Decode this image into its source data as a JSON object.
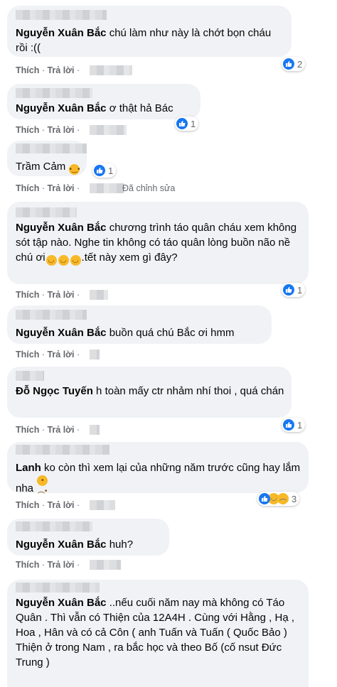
{
  "comments": [
    {
      "author": "Nguyễn Xuân Bắc",
      "text": " chú làm như này là chớt bọn cháu rồi :((",
      "like": "Thích",
      "reply": "Trả lời",
      "reactions": "2"
    },
    {
      "author": "Nguyễn Xuân Bắc",
      "text": " ơ thật hả Bác",
      "like": "Thích",
      "reply": "Trả lời",
      "reactions": "1"
    },
    {
      "author": "",
      "text": "Trầm Cảm ",
      "like": "Thích",
      "reply": "Trả lời",
      "edited": "Đã chỉnh sửa",
      "reactions": "1"
    },
    {
      "author": "Nguyễn Xuân Bắc",
      "text": " chương trình táo quân cháu xem không sót tập nào. Nghe tin không có táo quân lòng buồn não nề chú ơi",
      "text_after": ".tết này xem gì đây?",
      "like": "Thích",
      "reply": "Trả lời",
      "reactions": "1"
    },
    {
      "author": "Nguyễn Xuân Bắc",
      "text": " buồn quá chú Bắc ơi hmm",
      "like": "Thích",
      "reply": "Trả lời"
    },
    {
      "author": "Đỗ Ngọc Tuyến",
      "text": " h toàn mấy ctr nhảm nhí thoi , quá chán",
      "like": "Thích",
      "reply": "Trả lời",
      "reactions": "1"
    },
    {
      "author": "Lanh",
      "text": " ko còn thì xem lại của những năm trước cũng hay lắm nha ",
      "like": "Thích",
      "reply": "Trả lời",
      "reactions": "3"
    },
    {
      "author": "Nguyễn Xuân Bắc",
      "text": " huh?",
      "like": "Thích",
      "reply": "Trả lời"
    },
    {
      "author": "Nguyễn Xuân Bắc",
      "text": " ..nếu cuối năm nay mà không có Táo Quân . Thì vẫn có Thiện của 12A4H . Cùng với Hằng , Hạ , Hoa , Hân và có cả Côn ( anh Tuấn và Tuấn ( Quốc Bảo )",
      "text2": "Thiện ở trong Nam , ra bắc học và theo Bố (cố nsut Đức Trung )"
    }
  ],
  "separator": " · ",
  "icons": {
    "like": "thumbs-up-icon",
    "emoji": "sad-face-emoji",
    "laugh": "laughing-face-emoji"
  },
  "colors": {
    "bubble": "#f0f2f5",
    "like_blue": "#1877f2",
    "meta": "#65676b"
  }
}
